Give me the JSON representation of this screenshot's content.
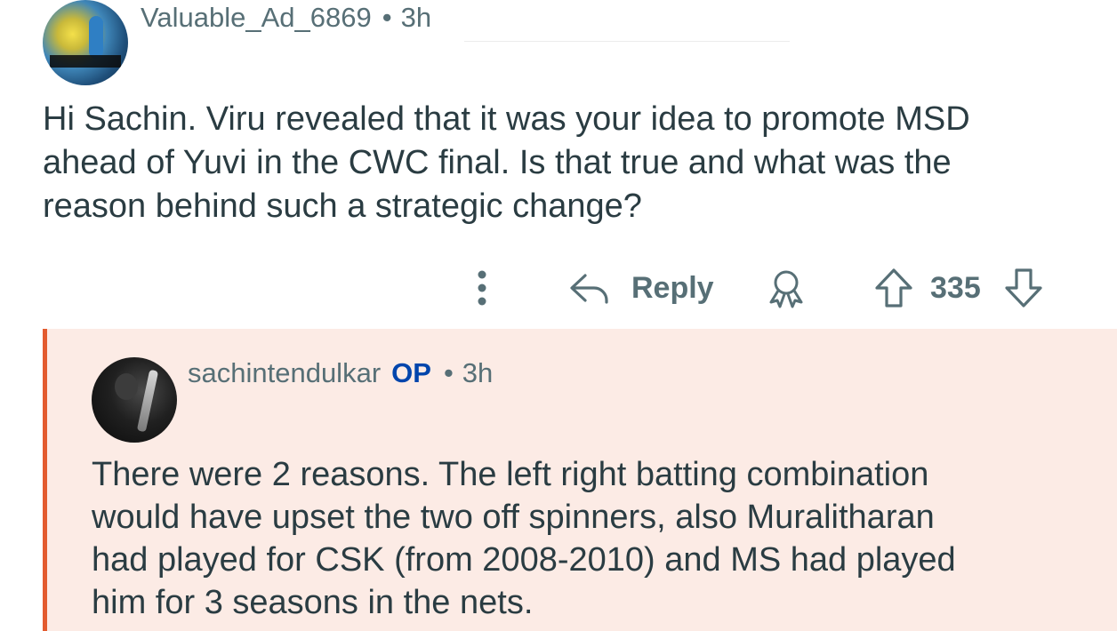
{
  "top_comment": {
    "username": "Valuable_Ad_6869",
    "separator": "•",
    "time": "3h",
    "body_lines": [
      "Hi Sachin. Viru revealed that it was your idea to promote MSD",
      "ahead of Yuvi in the CWC final. Is that true and what was the",
      "reason behind such a strategic change?"
    ],
    "actions": {
      "reply_label": "Reply",
      "score": "335"
    }
  },
  "reply_comment": {
    "username": "sachintendulkar",
    "op_badge": "OP",
    "separator": "•",
    "time": "3h",
    "body_lines": [
      "There were 2 reasons. The left right batting combination",
      "would have upset the two off spinners, also Muralitharan",
      "had played for CSK (from 2008-2010) and MS had played",
      "him for 3 seasons in the nets."
    ]
  },
  "colors": {
    "meta_gray": "#576f76",
    "body_text": "#2a3c42",
    "op_blue": "#0045ac",
    "highlight_bg": "#fcebe5",
    "highlight_border": "#e35b2f"
  },
  "icons": {
    "more": "more-vertical-icon",
    "reply": "reply-arrow-icon",
    "award": "award-icon",
    "upvote": "upvote-arrow-icon",
    "downvote": "downvote-arrow-icon"
  }
}
